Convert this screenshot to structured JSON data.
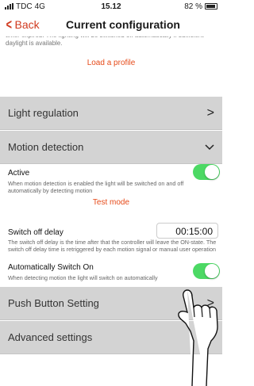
{
  "status": {
    "carrier": "TDC",
    "network": "4G",
    "time": "15.12",
    "battery": "82 %"
  },
  "nav": {
    "back_label": "Back",
    "title": "Current configuration"
  },
  "intro": {
    "note": "timer expired. The lighting will be switched off automatically if sufficient daylight is available.",
    "load_profile": "Load a profile"
  },
  "sections": {
    "light_regulation": "Light regulation",
    "motion_detection": "Motion detection",
    "push_button": "Push Button Setting",
    "advanced": "Advanced settings"
  },
  "motion": {
    "active_label": "Active",
    "active_on": true,
    "active_desc": "When motion detection is enabled the light will be switched on and off automatically by detecting motion",
    "test_mode": "Test mode",
    "delay_label": "Switch off delay",
    "delay_value": "00:15:00",
    "delay_desc": "The switch off delay is the time after that the controller will leave the ON-state. The switch off delay time is retriggered by each motion signal or manual user operation",
    "auto_label": "Automatically Switch On",
    "auto_on": true,
    "auto_desc": "When detecting motion the light will switch on automatically"
  },
  "colors": {
    "accent": "#e64a19",
    "back": "#d03a1f",
    "toggle_on": "#4cd964",
    "section_bg": "#d3d3d3"
  },
  "icons": {
    "back": "chevron-left-icon",
    "section_closed": "chevron-right-icon",
    "section_open": "chevron-down-icon",
    "battery": "battery-icon",
    "signal": "signal-icon",
    "touch": "hand-pointer-icon"
  }
}
